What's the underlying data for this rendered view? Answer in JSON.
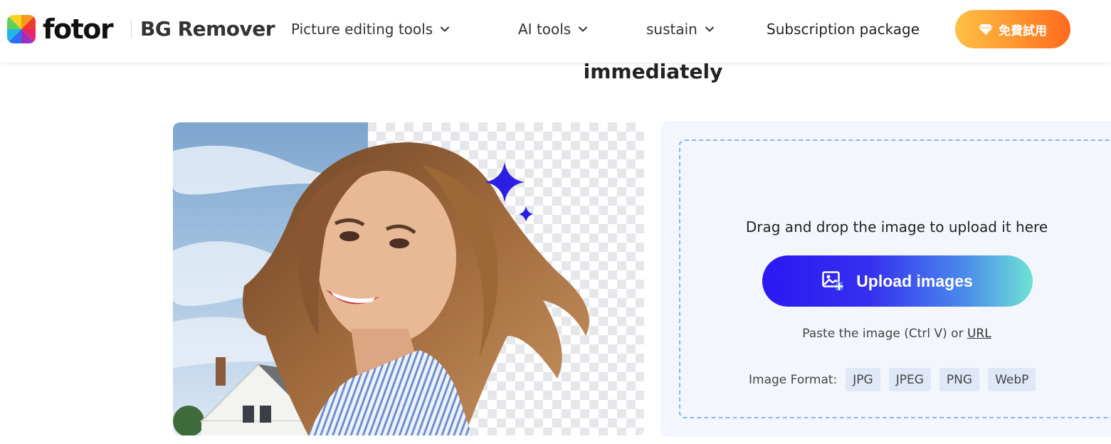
{
  "header": {
    "logo_text": "fotor",
    "product_name": "BG Remover",
    "nav": [
      {
        "label": "Picture editing tools"
      },
      {
        "label": "AI tools"
      },
      {
        "label": "sustain"
      },
      {
        "label": "Subscription package"
      }
    ],
    "trial_button": "免費試用",
    "trial_gradient": [
      "#ffc046",
      "#ff6a1f"
    ]
  },
  "main": {
    "heading": "immediately",
    "demo": {
      "alt": "Woman with background removed",
      "icons": [
        "sparkle-icon"
      ]
    },
    "upload": {
      "drop_text": "Drag and drop the image to upload it here",
      "upload_button": "Upload images",
      "paste_text": "Paste the image (Ctrl V) or",
      "url_link": "URL",
      "format_label": "Image Format:",
      "formats": [
        "JPG",
        "JPEG",
        "PNG",
        "WebP"
      ],
      "accent_color": "#2a18f2"
    }
  }
}
